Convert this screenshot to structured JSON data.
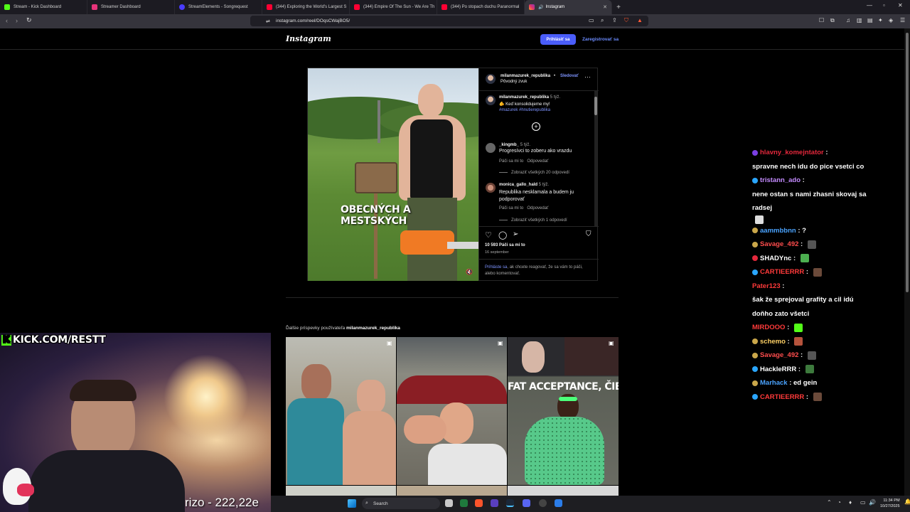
{
  "browser": {
    "tabs": [
      {
        "label": "Stream - Kick Dashboard",
        "color": "#53fc18"
      },
      {
        "label": "Streamer Dashboard",
        "color": "#e6337a"
      },
      {
        "label": "StreamElements - Songrequest",
        "color": "#4a3cff"
      },
      {
        "label": "(344) Exploring the World's Largest S",
        "color": "#ff0033"
      },
      {
        "label": "(344) Empire Of The Sun - We Are Th",
        "color": "#ff0033"
      },
      {
        "label": "(344) Po stopach duchu Paranormal",
        "color": "#ff0033"
      },
      {
        "label": "Instagram",
        "color": "#e1306c",
        "active": true
      }
    ],
    "url": "instagram.com/reel/DOqsCWajBO5/"
  },
  "instagram": {
    "logo": "Instagram",
    "login_label": "Prihlásiť sa",
    "signup_label": "Zaregistrovať sa",
    "post": {
      "author": "milanmazurek_republika",
      "follow": "Sledovať",
      "audio": "Pôvodný zvuk",
      "overlay_text": "OBECNÝCH A MESTSKÝCH",
      "caption_time": "5 týž.",
      "caption_line1": "🫵 Keď konsolidujeme my!",
      "caption_tags": "#mazurek #hnutierepublika",
      "comments": [
        {
          "user": "_kingmb_",
          "time": "5 týž.",
          "text": "Progresívci to zoberu ako vrazdu",
          "like": "Páči sa mi to",
          "reply": "Odpovedať",
          "replies": "Zobraziť všetkých 20 odpovedí"
        },
        {
          "user": "monica_gallo_hald",
          "time": "5 týž.",
          "text": "Republika nesklamala a budem ju podporovať",
          "like": "Páči sa mi to",
          "reply": "Odpovedať",
          "replies": "Zobraziť všetkých 1 odpovedí"
        }
      ],
      "likes": "10 593 Páči sa mi to",
      "date": "16 september",
      "login_prompt_link": "Prihláste sa",
      "login_prompt_rest": ", ak chcete reagovať, že sa vám to páči, alebo komentovať."
    },
    "more_label_prefix": "Ďalšie príspevky používateľa",
    "more_label_user": "milanmazurek_republika",
    "thumb_caption": "FAT ACCEPTANCE, ČIERNA"
  },
  "chat": [
    {
      "user": "hlavny_komejntator",
      "color": "#e5283c",
      "badge": "#7b3fe4",
      "text": "spravne nech idu do pice vsetci co",
      "emote": ""
    },
    {
      "user": "tristann_ado",
      "color": "#c48bff",
      "badge": "#2aa6ff",
      "text": "nene ostan s nami zhasni skovaj sa radsej",
      "emote": "#ddd"
    },
    {
      "user": "aammbbnn",
      "color": "#4aa3ff",
      "badge": "#caa74a",
      "text": "?",
      "emote": ""
    },
    {
      "user": "Savage_492",
      "color": "#ff4d4d",
      "badge": "#caa74a",
      "text": "",
      "emote": "#555"
    },
    {
      "user": "SHADYnc",
      "color": "#ffffff",
      "badge": "#e5283c",
      "text": "",
      "emote": "#4caf50"
    },
    {
      "user": "CARTIEERRR",
      "color": "#ff3a3a",
      "badge": "#2aa6ff",
      "text": "",
      "emote": "#6b4a3a"
    },
    {
      "user": "Pater123",
      "color": "#ff3a3a",
      "badge": "",
      "text": "šak že sprejoval grafity a cil idú doňho zato všetci",
      "emote": ""
    },
    {
      "user": "MIRDOOO",
      "color": "#ff3a3a",
      "badge": "",
      "text": "",
      "emote": "#53fc18"
    },
    {
      "user": "schemo",
      "color": "#ffd166",
      "badge": "#caa74a",
      "text": "",
      "emote": "#b5533c"
    },
    {
      "user": "Savage_492",
      "color": "#ff4d4d",
      "badge": "#caa74a",
      "text": "",
      "emote": "#555"
    },
    {
      "user": "HackleRRR",
      "color": "#ffffff",
      "badge": "#2aa6ff",
      "text": "",
      "emote": "#3d7a3d"
    },
    {
      "user": "Marhack",
      "color": "#4aa3ff",
      "badge": "#caa74a",
      "text": "ed gein",
      "emote": ""
    },
    {
      "user": "CARTIEERRR",
      "color": "#ff3a3a",
      "badge": "#2aa6ff",
      "text": "",
      "emote": "#6b4a3a"
    }
  ],
  "overlay": {
    "kick_label": "KICK.COM/RESTT",
    "counter": "rizo - 222,22e"
  },
  "taskbar": {
    "search_placeholder": "Search",
    "time": "11:34 PM",
    "date": "10/27/2025"
  }
}
